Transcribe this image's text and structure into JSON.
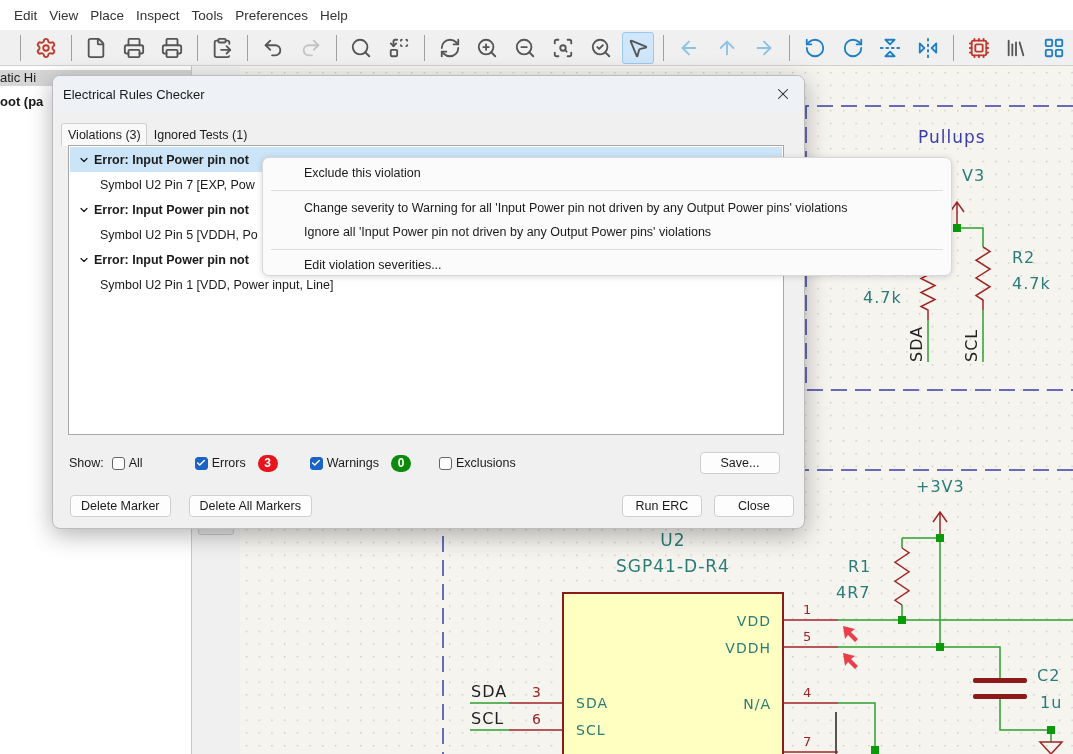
{
  "menubar": [
    {
      "label": "Edit"
    },
    {
      "label": "View"
    },
    {
      "label": "Place"
    },
    {
      "label": "Inspect"
    },
    {
      "label": "Tools"
    },
    {
      "label": "Preferences"
    },
    {
      "label": "Help"
    }
  ],
  "toolbar": {
    "groups": [
      [
        {
          "selected": false,
          "disabled": false
        }
      ],
      [
        {
          "selected": false,
          "disabled": false
        },
        {
          "selected": false,
          "disabled": false
        },
        {
          "selected": false,
          "disabled": false
        }
      ],
      [
        {
          "selected": false,
          "disabled": false
        }
      ],
      [
        {
          "selected": false,
          "disabled": false
        },
        {
          "selected": false,
          "disabled": true
        }
      ],
      [
        {
          "selected": false,
          "disabled": false
        },
        {
          "selected": false,
          "disabled": false
        }
      ],
      [
        {
          "selected": false,
          "disabled": false
        },
        {
          "selected": false,
          "disabled": false
        },
        {
          "selected": false,
          "disabled": false
        },
        {
          "selected": false,
          "disabled": false
        },
        {
          "selected": false,
          "disabled": false
        },
        {
          "selected": true,
          "disabled": false
        }
      ],
      [
        {
          "selected": false,
          "disabled": false
        },
        {
          "selected": false,
          "disabled": false
        },
        {
          "selected": false,
          "disabled": false
        }
      ],
      [
        {
          "selected": false,
          "disabled": false
        },
        {
          "selected": false,
          "disabled": false
        },
        {
          "selected": false,
          "disabled": false
        },
        {
          "selected": false,
          "disabled": false
        }
      ],
      [
        {
          "selected": false,
          "disabled": false
        },
        {
          "selected": false,
          "disabled": false
        },
        {
          "selected": false,
          "disabled": false
        }
      ]
    ]
  },
  "hierarchy": {
    "header": "atic Hi",
    "root": "oot (pa"
  },
  "schematic": {
    "pullups_sheet": {
      "title": "Pullups",
      "power": "V3",
      "r3_value": "4.7k",
      "r2_ref": "R2",
      "r2_value": "4.7k",
      "net_labels": [
        "SDA",
        "SCL"
      ]
    },
    "sensor_sheet": {
      "power": "+3V3",
      "u2_ref": "U2",
      "u2_value": "SGP41-D-R4",
      "r1_ref": "R1",
      "r1_value": "4R7",
      "c2_ref": "C2",
      "c2_value": "1u",
      "right_pins": [
        {
          "name": "VDD",
          "number": "1"
        },
        {
          "name": "VDDH",
          "number": "5"
        },
        {
          "name": "N/A",
          "number": "4"
        },
        {
          "number": "7"
        }
      ],
      "left_pins": [
        {
          "name": "SDA",
          "number": "3"
        },
        {
          "name": "SCL",
          "number": "6"
        }
      ],
      "net_labels": [
        "SDA",
        "SCL"
      ]
    }
  },
  "dialog": {
    "title": "Electrical Rules Checker",
    "tabs": [
      {
        "label": "Violations (3)",
        "selected": true
      },
      {
        "label": "Ignored Tests (1)",
        "selected": false
      }
    ],
    "violations": [
      {
        "title": "Error: Input Power pin not",
        "expanded": true,
        "selected": true,
        "children": [
          {
            "text": "Symbol U2 Pin 7 [EXP, Pow",
            "selected": false
          }
        ]
      },
      {
        "title": "Error: Input Power pin not",
        "expanded": true,
        "selected": false,
        "children": [
          {
            "text": "Symbol U2 Pin 5 [VDDH, Po",
            "selected": false
          }
        ]
      },
      {
        "title": "Error: Input Power pin not",
        "expanded": true,
        "selected": false,
        "children": [
          {
            "text": "Symbol U2 Pin 1 [VDD, Power input, Line]",
            "selected": false
          }
        ]
      }
    ],
    "show_label": "Show:",
    "filters": [
      {
        "label": "All",
        "checked": false
      },
      {
        "label": "Errors",
        "checked": true,
        "count": "3",
        "color": "#e8141b"
      },
      {
        "label": "Warnings",
        "checked": true,
        "count": "0",
        "color": "#0a8a0a"
      },
      {
        "label": "Exclusions",
        "checked": false
      }
    ],
    "save_button": "Save...",
    "left_buttons": [
      "Delete Marker",
      "Delete All Markers"
    ],
    "right_buttons": [
      "Run ERC",
      "Close"
    ]
  },
  "context_menu": [
    {
      "kind": "item",
      "label": "Exclude this violation"
    },
    {
      "kind": "separator"
    },
    {
      "kind": "item",
      "label": "Change severity to Warning for all 'Input Power pin not driven by any Output Power pins' violations"
    },
    {
      "kind": "item",
      "label": "Ignore all 'Input Power pin not driven by any Output Power pins' violations"
    },
    {
      "kind": "separator"
    },
    {
      "kind": "item",
      "label": "Edit violation severities..."
    }
  ]
}
